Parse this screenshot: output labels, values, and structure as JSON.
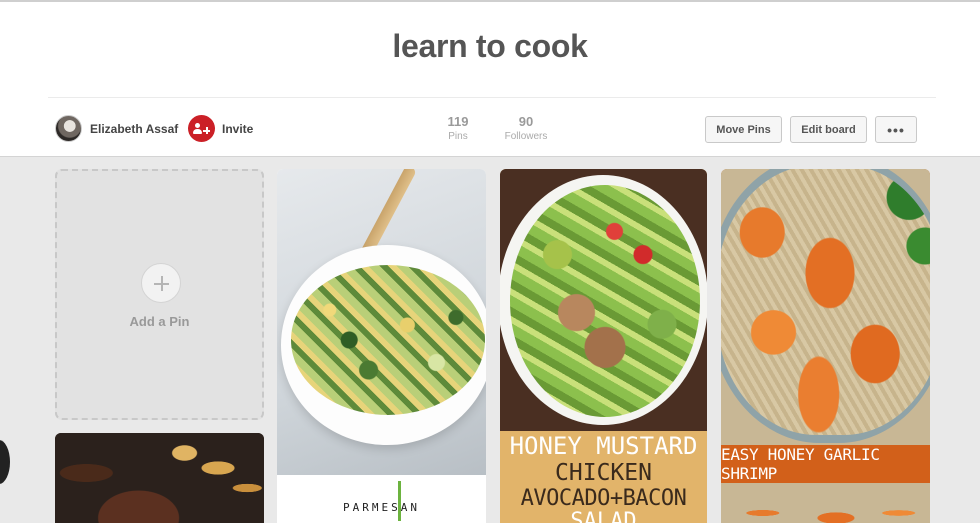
{
  "board": {
    "title": "learn to cook",
    "owner_name": "Elizabeth Assaf",
    "invite_label": "Invite",
    "stats": {
      "pins_count": "119",
      "pins_label": "Pins",
      "followers_count": "90",
      "followers_label": "Followers"
    }
  },
  "toolbar": {
    "move_pins_label": "Move Pins",
    "edit_board_label": "Edit board",
    "more_label": "•••"
  },
  "add_pin": {
    "label": "Add a Pin"
  },
  "pins": [
    {
      "id": "zucchini",
      "overlay_text": "PARMESAN"
    },
    {
      "id": "chicken",
      "overlay_lines": [
        "HONEY MUSTARD",
        "CHICKEN",
        "AVOCADO+BACON",
        "SALAD"
      ]
    },
    {
      "id": "shrimp",
      "overlay_text": "EASY HONEY GARLIC SHRIMP"
    },
    {
      "id": "steak"
    }
  ],
  "colors": {
    "invite_red": "#cb2027",
    "page_bg": "#e9e9e9",
    "shrimp_banner": "#d2601a",
    "chicken_caption": "#e2b46a"
  }
}
